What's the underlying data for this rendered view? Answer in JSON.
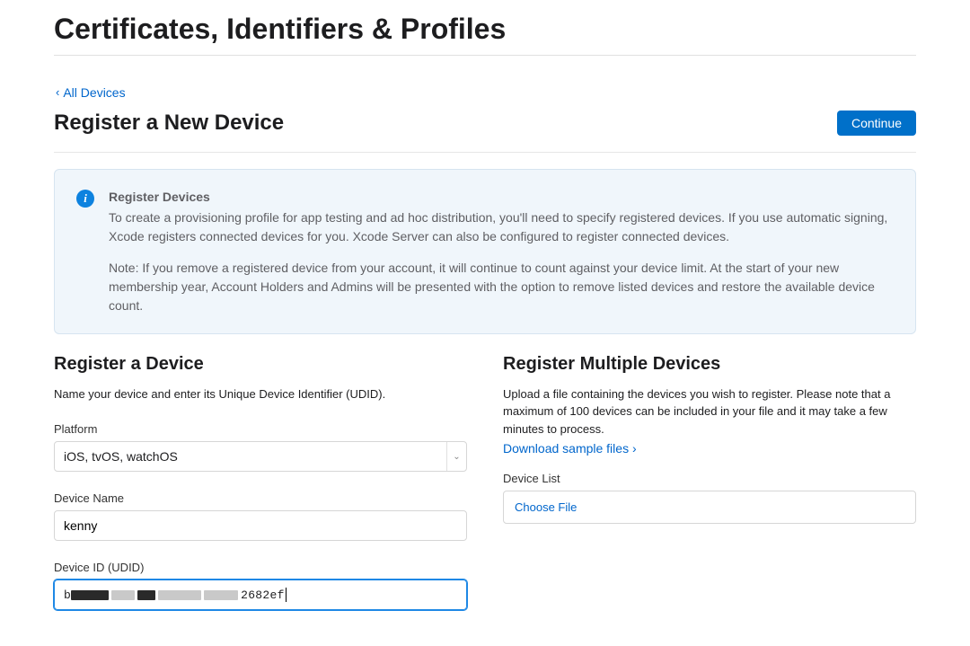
{
  "header": {
    "title": "Certificates, Identifiers & Profiles"
  },
  "nav": {
    "back_label": "All Devices"
  },
  "page": {
    "subtitle": "Register a New Device",
    "continue_label": "Continue"
  },
  "info": {
    "title": "Register Devices",
    "para1": "To create a provisioning profile for app testing and ad hoc distribution, you'll need to specify registered devices. If you use automatic signing, Xcode registers connected devices for you. Xcode Server can also be configured to register connected devices.",
    "para2": "Note: If you remove a registered device from your account, it will continue to count against your device limit. At the start of your new membership year, Account Holders and Admins will be presented with the option to remove listed devices and restore the available device count."
  },
  "single": {
    "title": "Register a Device",
    "desc": "Name your device and enter its Unique Device Identifier (UDID).",
    "platform_label": "Platform",
    "platform_value": "iOS, tvOS, watchOS",
    "name_label": "Device Name",
    "name_value": "kenny",
    "udid_label": "Device ID (UDID)",
    "udid_prefix": "b",
    "udid_visible_suffix": "2682ef"
  },
  "multi": {
    "title": "Register Multiple Devices",
    "desc": "Upload a file containing the devices you wish to register. Please note that a maximum of 100 devices can be included in your file and it may take a few minutes to process.",
    "download_link": "Download sample files ›",
    "list_label": "Device List",
    "choose_file": "Choose File"
  }
}
